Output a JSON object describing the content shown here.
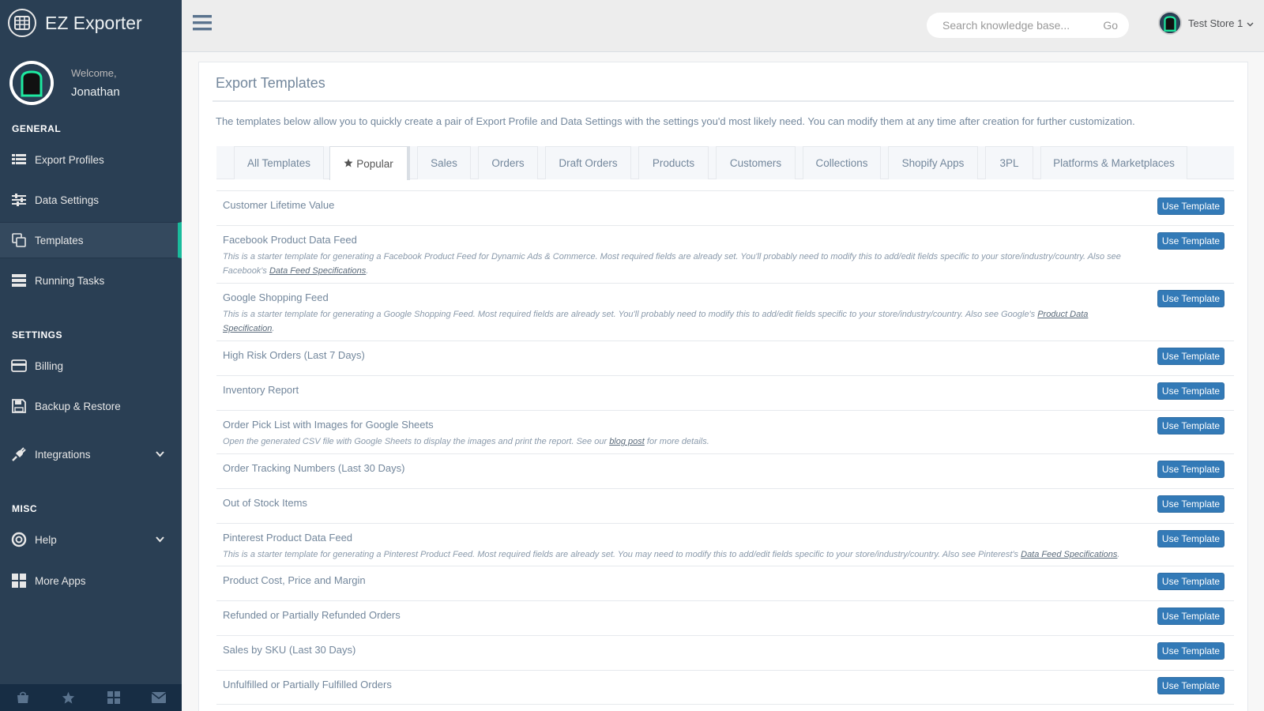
{
  "app": {
    "title": "EZ Exporter"
  },
  "profile": {
    "welcome": "Welcome,",
    "name": "Jonathan"
  },
  "sidebar": {
    "general_label": "GENERAL",
    "settings_label": "SETTINGS",
    "misc_label": "MISC",
    "items": [
      {
        "label": "Export Profiles",
        "icon": "table-icon"
      },
      {
        "label": "Data Settings",
        "icon": "sliders-icon"
      },
      {
        "label": "Templates",
        "icon": "copy-icon",
        "active": true
      },
      {
        "label": "Running Tasks",
        "icon": "server-icon"
      },
      {
        "label": "Billing",
        "icon": "credit-card-icon"
      },
      {
        "label": "Backup & Restore",
        "icon": "save-icon"
      },
      {
        "label": "Integrations",
        "icon": "plug-icon"
      },
      {
        "label": "Help",
        "icon": "life-ring-icon"
      },
      {
        "label": "More Apps",
        "icon": "grid-icon"
      }
    ]
  },
  "topnav": {
    "search_placeholder": "Search knowledge base...",
    "go_label": "Go",
    "store_name": "Test Store 1"
  },
  "panel": {
    "title": "Export Templates",
    "description": "The templates below allow you to quickly create a pair of Export Profile and Data Settings with the settings you'd most likely need. You can modify them at any time after creation for further customization."
  },
  "tabs": [
    "All Templates",
    "Popular",
    "Sales",
    "Orders",
    "Draft Orders",
    "Products",
    "Customers",
    "Collections",
    "Shopify Apps",
    "3PL",
    "Platforms & Marketplaces"
  ],
  "button_label": "Use Template",
  "templates": [
    {
      "name": "Customer Lifetime Value"
    },
    {
      "name": "Facebook Product Data Feed",
      "desc_pre": "This is a starter template for generating a Facebook Product Feed for Dynamic Ads & Commerce. Most required fields are already set. You'll probably need to modify this to add/edit fields specific to your store/industry/country. Also see Facebook's ",
      "desc_link": "Data Feed Specifications",
      "desc_post": "."
    },
    {
      "name": "Google Shopping Feed",
      "desc_pre": "This is a starter template for generating a Google Shopping Feed. Most required fields are already set. You'll probably need to modify this to add/edit fields specific to your store/industry/country. Also see Google's ",
      "desc_link": "Product Data Specification",
      "desc_post": "."
    },
    {
      "name": "High Risk Orders (Last 7 Days)"
    },
    {
      "name": "Inventory Report"
    },
    {
      "name": "Order Pick List with Images for Google Sheets",
      "desc_pre": "Open the generated CSV file with Google Sheets to display the images and print the report. See our ",
      "desc_link": "blog post",
      "desc_post": " for more details."
    },
    {
      "name": "Order Tracking Numbers (Last 30 Days)"
    },
    {
      "name": "Out of Stock Items"
    },
    {
      "name": "Pinterest Product Data Feed",
      "desc_pre": "This is a starter template for generating a Pinterest Product Feed. Most required fields are already set. You may need to modify this to add/edit fields specific to your store/industry/country. Also see Pinterest's ",
      "desc_link": "Data Feed Specifications",
      "desc_post": "."
    },
    {
      "name": "Product Cost, Price and Margin"
    },
    {
      "name": "Refunded or Partially Refunded Orders"
    },
    {
      "name": "Sales by SKU (Last 30 Days)"
    },
    {
      "name": "Unfulfilled or Partially Fulfilled Orders"
    }
  ],
  "colors": {
    "sidebar": "#2a3f54",
    "accent": "#1abb9c",
    "button": "#337ab7"
  }
}
